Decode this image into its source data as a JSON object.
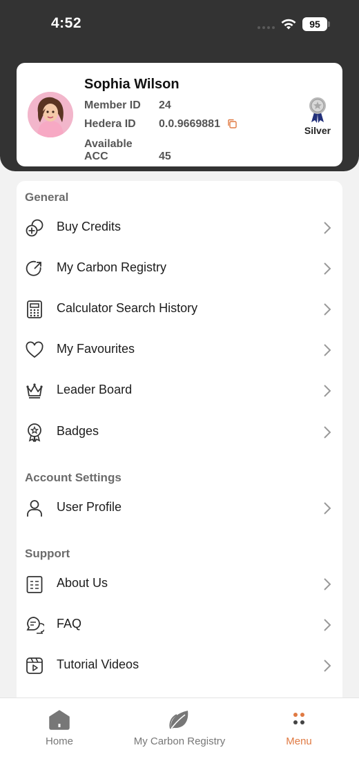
{
  "status_bar": {
    "time": "4:52",
    "battery": "95"
  },
  "profile": {
    "name": "Sophia Wilson",
    "member_id_label": "Member ID",
    "member_id": "24",
    "hedera_id_label": "Hedera ID",
    "hedera_id": "0.0.9669881",
    "available_acc_label": "Available ACC",
    "available_acc": "45",
    "tier": "Silver"
  },
  "menu": {
    "general_title": "General",
    "general": [
      {
        "label": "Buy Credits",
        "icon": "buy-credits-icon"
      },
      {
        "label": "My Carbon Registry",
        "icon": "carbon-registry-icon"
      },
      {
        "label": "Calculator Search History",
        "icon": "calculator-icon"
      },
      {
        "label": "My Favourites",
        "icon": "heart-icon"
      },
      {
        "label": "Leader Board",
        "icon": "crown-icon"
      },
      {
        "label": "Badges",
        "icon": "badge-icon"
      }
    ],
    "account_title": "Account Settings",
    "account": [
      {
        "label": "User Profile",
        "icon": "user-icon"
      }
    ],
    "support_title": "Support",
    "support": [
      {
        "label": "About Us",
        "icon": "document-icon"
      },
      {
        "label": "FAQ",
        "icon": "chat-icon"
      },
      {
        "label": "Tutorial Videos",
        "icon": "video-icon"
      }
    ]
  },
  "bottom_nav": {
    "home": "Home",
    "registry": "My Carbon Registry",
    "menu": "Menu"
  },
  "colors": {
    "accent": "#e07a43",
    "header": "#333333",
    "background": "#f2f2f2"
  }
}
